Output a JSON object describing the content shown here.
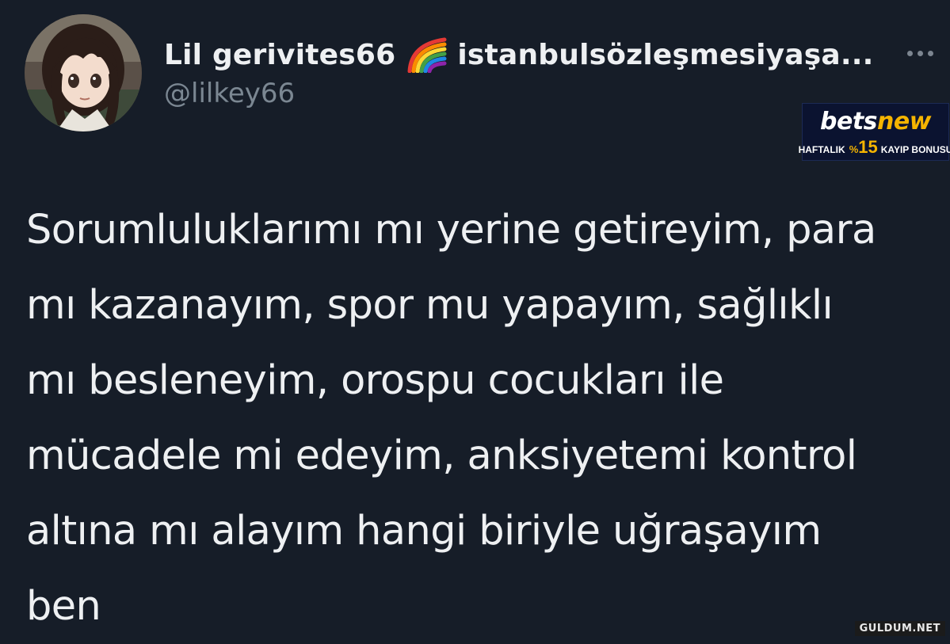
{
  "tweet": {
    "display_name": "Lil gerivites66",
    "display_name_suffix": "istanbulsözleşmesiyaşa...",
    "handle": "@lilkey66",
    "name_emoji_icon": "rainbow-emoji",
    "more_icon": "ellipsis-icon",
    "text_lines": [
      "Sorumluluklarımı mı yerine getireyim, para",
      "mı kazanayım, spor mu yapayım, sağlıklı",
      "mı besleneyim, orospu cocukları ile",
      "mücadele mi edeyim, anksiyetemi kontrol",
      "altına mı alayım hangi biriyle uğraşayım",
      "ben"
    ]
  },
  "ad": {
    "logo_main": "bets",
    "logo_accent": "new",
    "tagline_left": "HAFTALIK",
    "tagline_pct": "%",
    "tagline_number": "15",
    "tagline_right": "KAYIP BONUSU"
  },
  "watermark": "GULDUM.NET",
  "colors": {
    "background": "#161d28",
    "text": "#eef0f2",
    "secondary_text": "#7b8792",
    "ad_accent": "#f5b400"
  }
}
